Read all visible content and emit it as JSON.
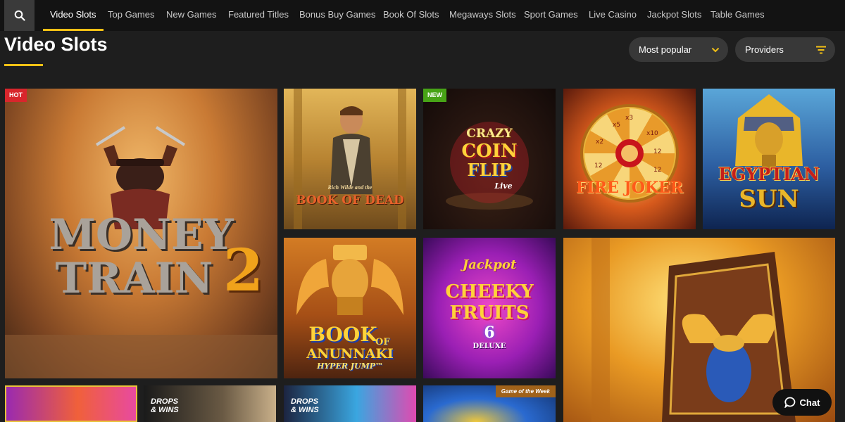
{
  "nav": {
    "tabs": [
      {
        "label": "Video Slots",
        "active": true
      },
      {
        "label": "Top Games",
        "active": false
      },
      {
        "label": "New Games",
        "active": false
      },
      {
        "label": "Featured Titles",
        "active": false
      },
      {
        "label": "Bonus Buy Games",
        "active": false
      },
      {
        "label": "Book Of Slots",
        "active": false
      },
      {
        "label": "Megaways Slots",
        "active": false
      },
      {
        "label": "Sport Games",
        "active": false
      },
      {
        "label": "Live Casino",
        "active": false
      },
      {
        "label": "Jackpot Slots",
        "active": false
      },
      {
        "label": "Table Games",
        "active": false
      }
    ]
  },
  "header": {
    "title": "Video Slots",
    "sort_label": "Most popular",
    "providers_label": "Providers"
  },
  "games": {
    "money_train_2": {
      "line1": "Money",
      "line2": "Train",
      "numeral": "2",
      "badge": "HOT"
    },
    "book_of_dead": {
      "brand": "Rich Wilde and the",
      "title": "Book of Dead"
    },
    "crazy_coin_flip": {
      "line1": "Crazy",
      "line2": "Coin",
      "line3": "Flip",
      "suffix": "Live",
      "badge": "NEW"
    },
    "fire_joker": {
      "title": "Fire Joker",
      "wheel_labels": [
        "x5",
        "x3",
        "x10",
        "12",
        "x2",
        "12",
        "12"
      ]
    },
    "egyptian_sun": {
      "line1": "Egyptian",
      "line2": "Sun"
    },
    "book_of_anunnaki": {
      "line1": "Book",
      "of": "of",
      "line2": "Anunnaki",
      "line3": "Hyper Jump™"
    },
    "cheeky_fruits": {
      "jackpot": "Jackpot",
      "line1": "Cheeky",
      "line2": "Fruits",
      "number": "6",
      "edition": "Deluxe"
    },
    "bottom_row": {
      "drops_label_1": "Drops",
      "drops_label_2": "& Wins",
      "game_of_week": "Game of the Week"
    }
  },
  "chat": {
    "label": "Chat"
  },
  "colors": {
    "accent": "#f3c115",
    "hot": "#d8262c",
    "new": "#47a316"
  }
}
